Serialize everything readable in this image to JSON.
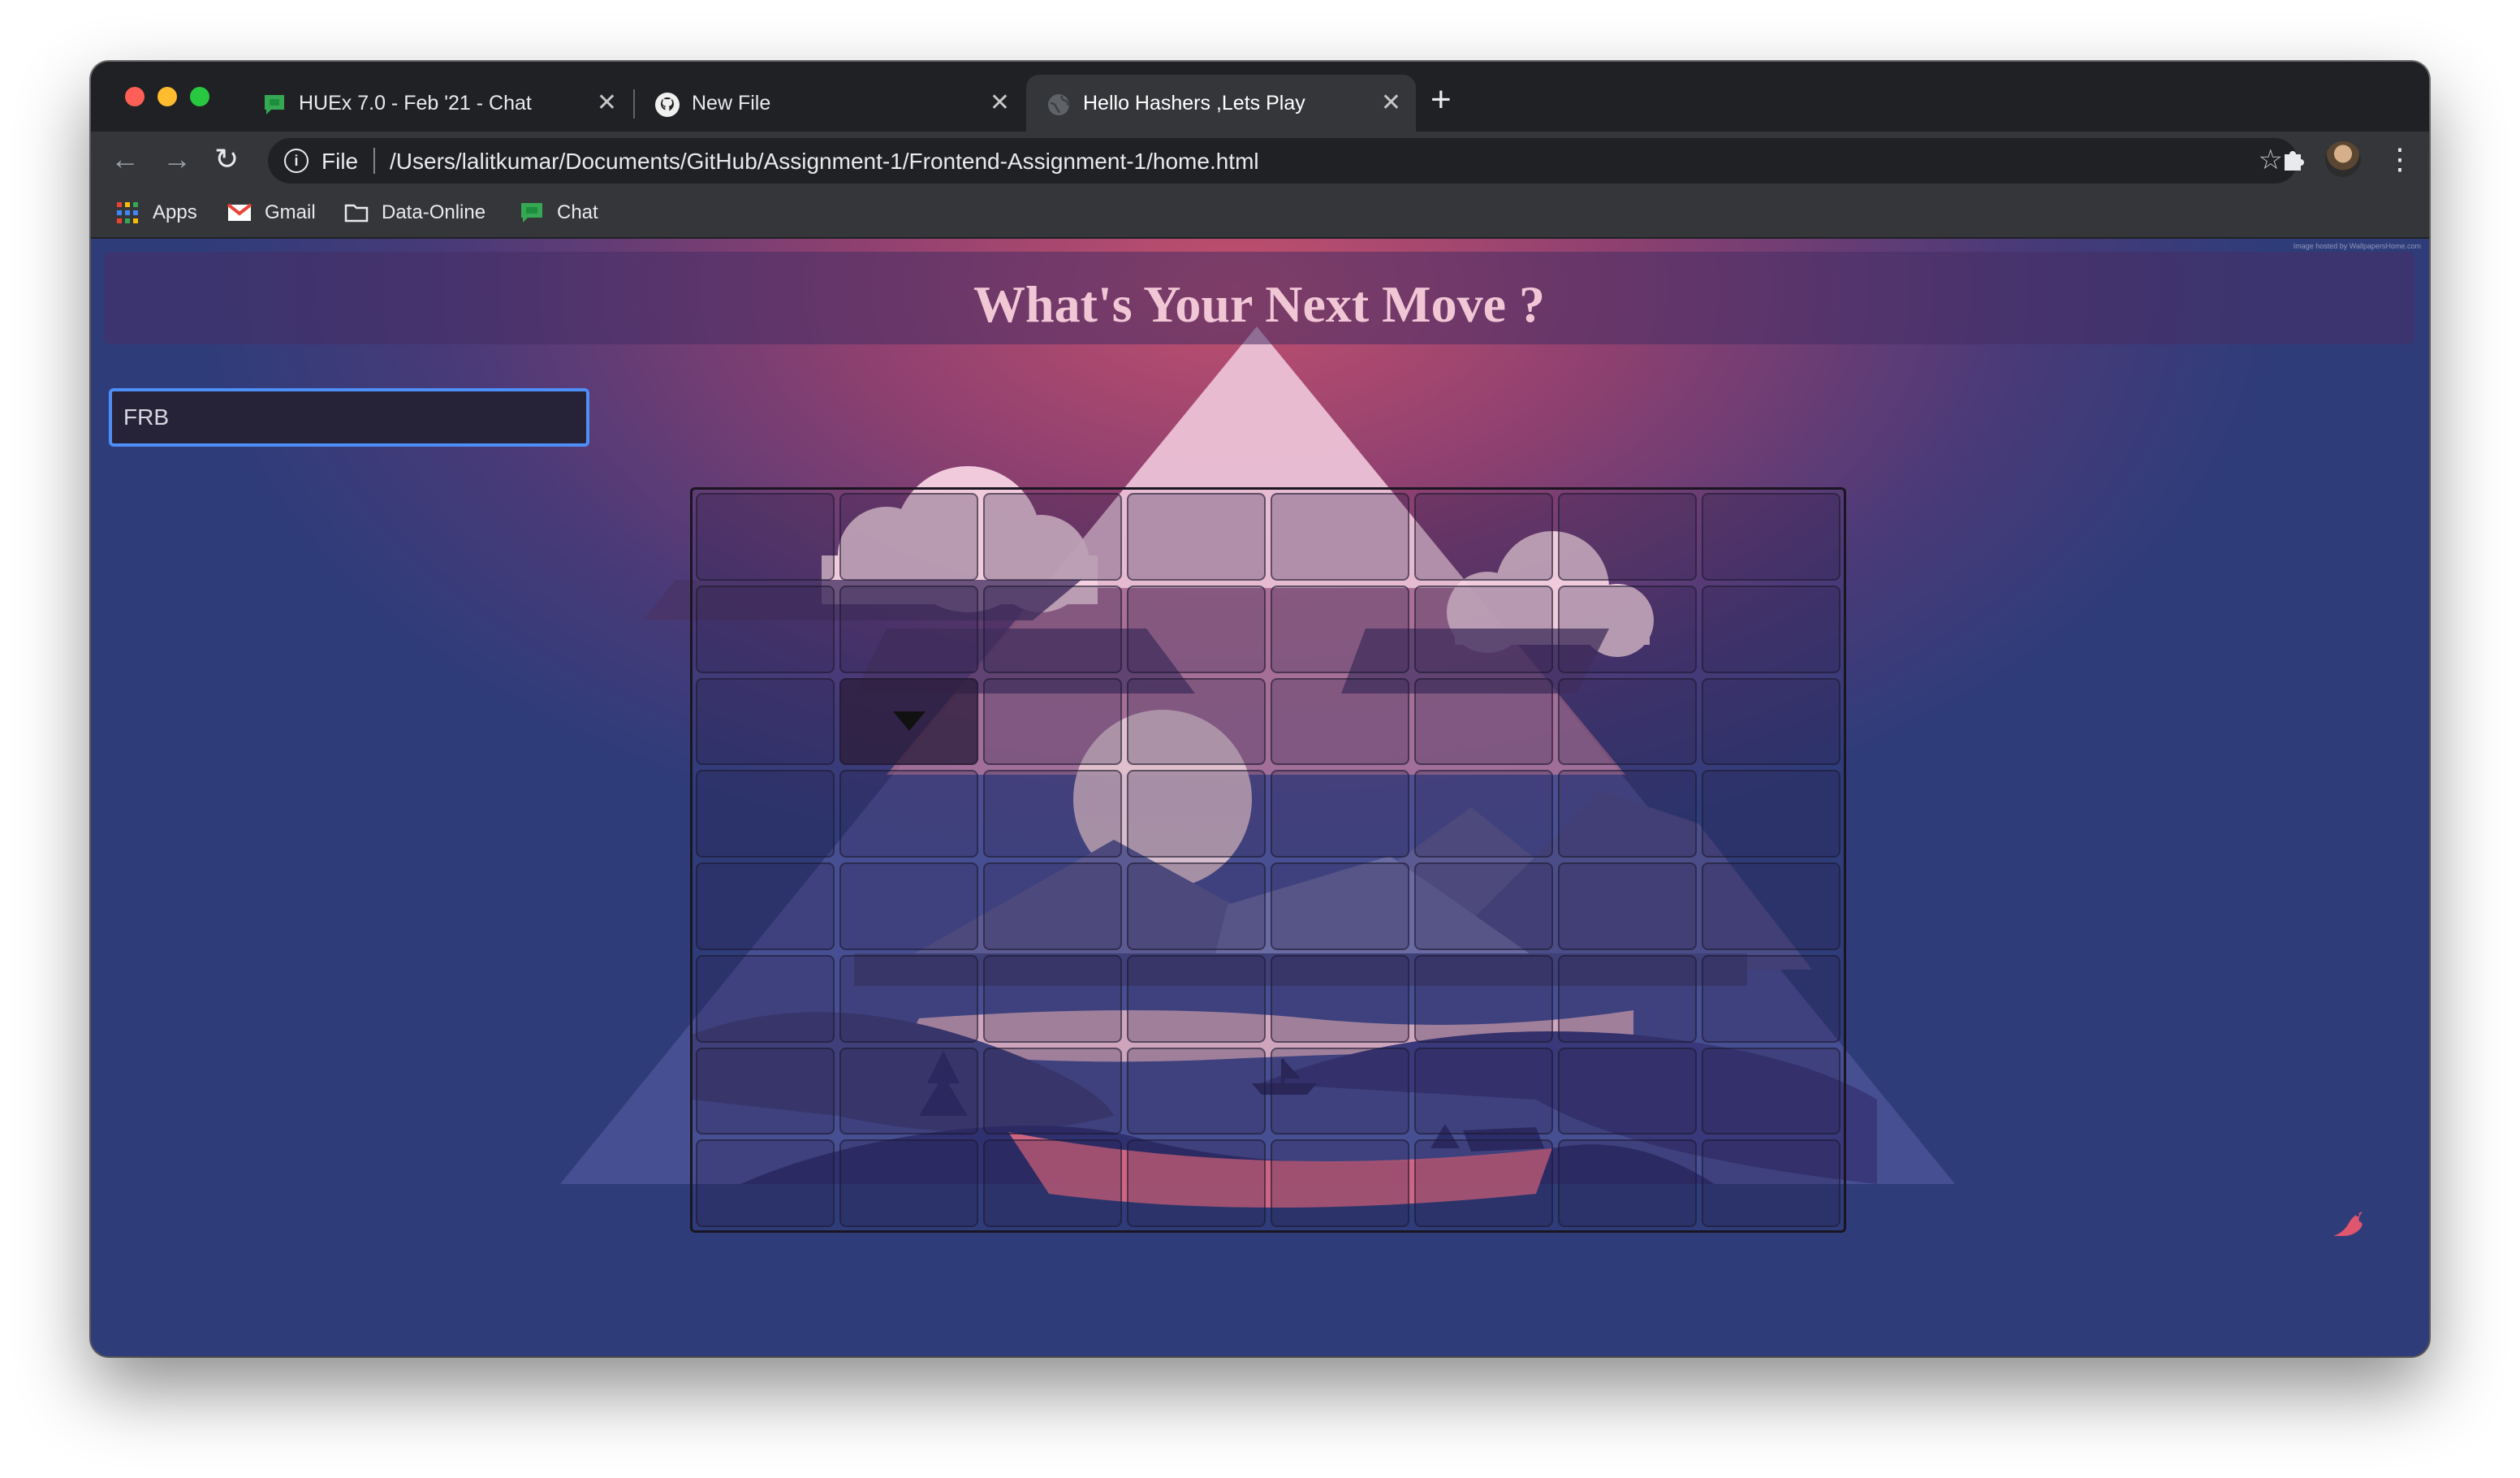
{
  "tabs": [
    {
      "title": "HUEx 7.0 - Feb '21 - Chat",
      "icon": "google-chat-icon",
      "active": false
    },
    {
      "title": "New File",
      "icon": "github-icon",
      "active": false
    },
    {
      "title": "Hello Hashers ,Lets Play",
      "icon": "globe-icon",
      "active": true
    }
  ],
  "toolbar": {
    "scheme": "File",
    "url": "/Users/lalitkumar/Documents/GitHub/Assignment-1/Frontend-Assignment-1/home.html"
  },
  "bookmarks": [
    {
      "label": "Apps",
      "icon": "apps-grid-icon"
    },
    {
      "label": "Gmail",
      "icon": "gmail-icon"
    },
    {
      "label": "Data-Online",
      "icon": "folder-icon"
    },
    {
      "label": "Chat",
      "icon": "google-chat-icon"
    }
  ],
  "page": {
    "title": "What's Your Next Move ?",
    "input_value": "FRB",
    "credit": "Image hosted by WallpapersHome.com",
    "grid": {
      "rows": 8,
      "cols": 8,
      "player_row": 3,
      "player_col": 2
    }
  },
  "colors": {
    "input_focus": "#4d8ef7",
    "title_color": "#f1c7d6"
  }
}
